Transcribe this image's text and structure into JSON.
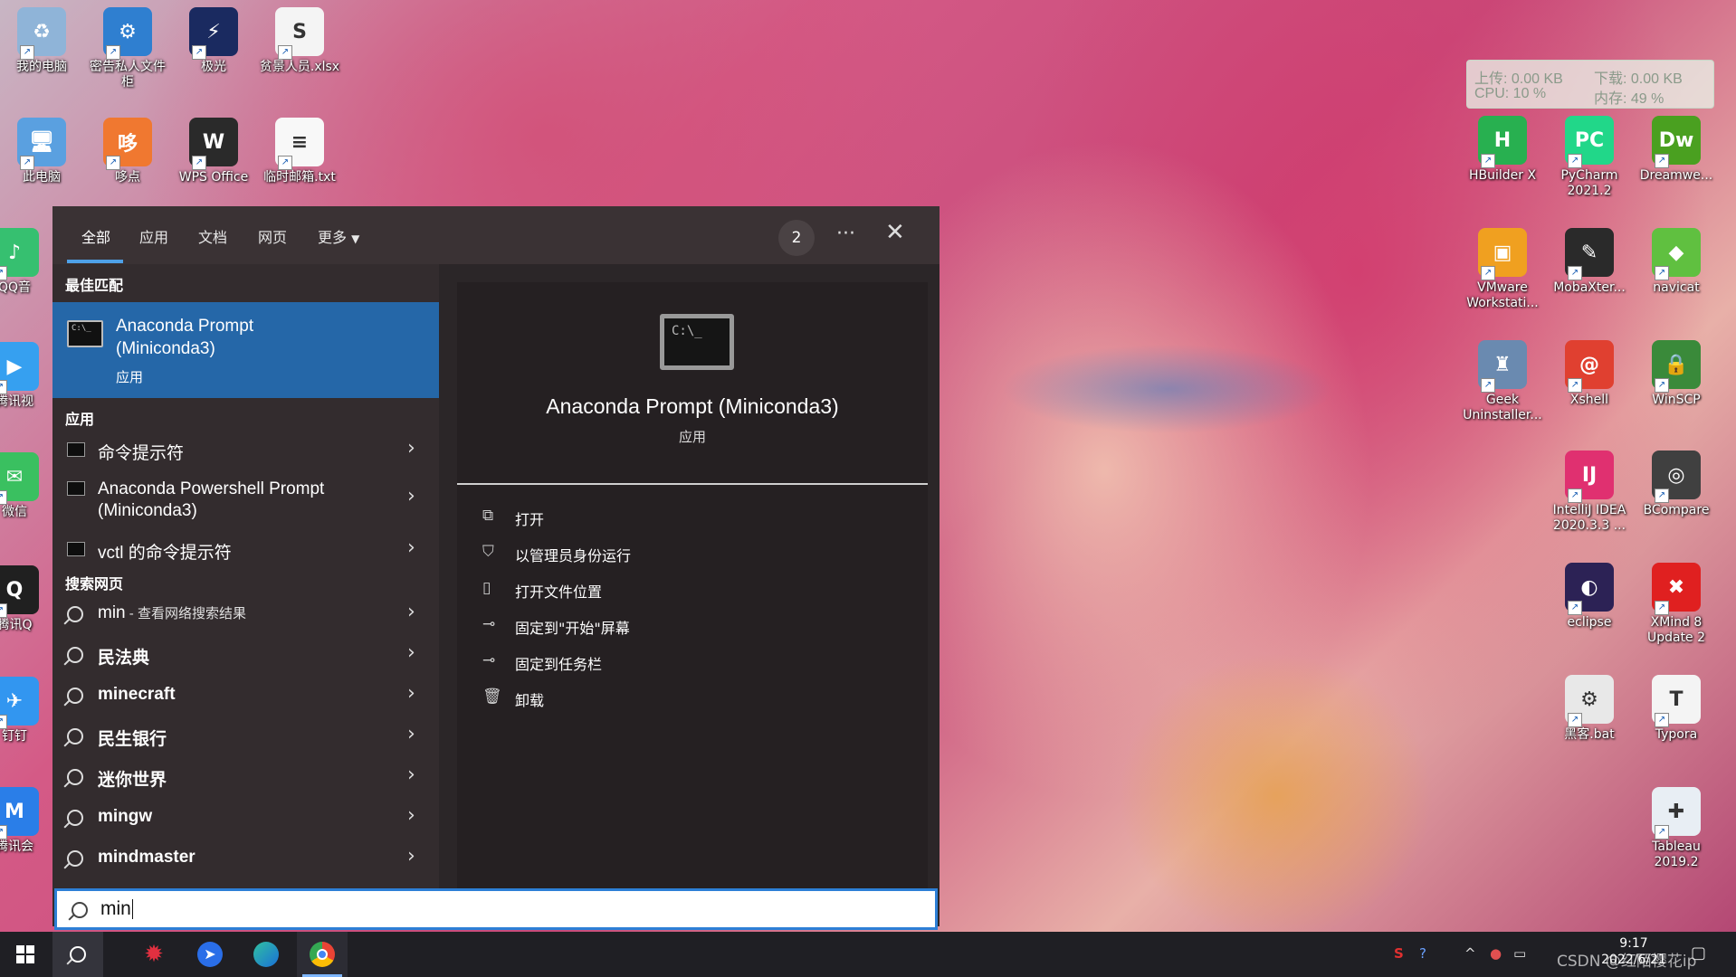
{
  "desktop": {
    "icons_left": [
      {
        "label": "我的电脑",
        "color": "#8fb4d8",
        "glyph": "♻"
      },
      {
        "label": "密告私人文件柜",
        "color": "#2f7fd0",
        "glyph": "⚙"
      },
      {
        "label": "极光",
        "color": "#1a2a60",
        "glyph": "⚡"
      },
      {
        "label": "贫景人员.xlsx",
        "color": "#f4f4f4",
        "glyph": "S"
      },
      {
        "label": "此电脑",
        "color": "#5aa0e0",
        "glyph": "🖥"
      },
      {
        "label": "哆点",
        "color": "#f07830",
        "glyph": "哆"
      },
      {
        "label": "WPS Office",
        "color": "#2a2a2a",
        "glyph": "W"
      },
      {
        "label": "临时邮箱.txt",
        "color": "#f8f8f8",
        "glyph": "≡"
      },
      {
        "label": "QQ音",
        "color": "#36c070",
        "glyph": "♪"
      },
      {
        "label": "腾讯视",
        "color": "#36a0f0",
        "glyph": "▶"
      },
      {
        "label": "微信",
        "color": "#3ac060",
        "glyph": "✉"
      },
      {
        "label": "腾讯Q",
        "color": "#202020",
        "glyph": "Q"
      },
      {
        "label": "钉钉",
        "color": "#3296f0",
        "glyph": "✈"
      },
      {
        "label": "腾讯会",
        "color": "#2a7ee8",
        "glyph": "M"
      }
    ],
    "icons_right": [
      {
        "label": "HBuilder X",
        "color": "#28b050",
        "glyph": "H"
      },
      {
        "label": "PyCharm 2021.2",
        "color": "#21d789",
        "glyph": "PC"
      },
      {
        "label": "Dreamwe...",
        "color": "#4aa020",
        "glyph": "Dw"
      },
      {
        "label": "VMware Workstati...",
        "color": "#f0a020",
        "glyph": "▣"
      },
      {
        "label": "MobaXter...",
        "color": "#2a2a2a",
        "glyph": "✎"
      },
      {
        "label": "navicat",
        "color": "#60c040",
        "glyph": "◆"
      },
      {
        "label": "Geek Uninstaller...",
        "color": "#6a8ab0",
        "glyph": "♜"
      },
      {
        "label": "Xshell",
        "color": "#e04030",
        "glyph": "@"
      },
      {
        "label": "WinSCP",
        "color": "#3a8a3a",
        "glyph": "🔒"
      },
      {
        "label": "IntelliJ IDEA 2020.3.3 ...",
        "color": "#e03070",
        "glyph": "IJ"
      },
      {
        "label": "BCompare",
        "color": "#404040",
        "glyph": "◎"
      },
      {
        "label": "eclipse",
        "color": "#2c2255",
        "glyph": "◐"
      },
      {
        "label": "XMind 8 Update 2",
        "color": "#e02020",
        "glyph": "✖"
      },
      {
        "label": "黑客.bat",
        "color": "#e8e8e8",
        "glyph": "⚙"
      },
      {
        "label": "Typora",
        "color": "#f4f4f4",
        "glyph": "T"
      },
      {
        "label": "Tableau 2019.2",
        "color": "#e8eef4",
        "glyph": "✚"
      }
    ]
  },
  "netmon": {
    "upload": "上传: 0.00 KB",
    "download": "下载: 0.00 KB",
    "cpu": "CPU: 10 %",
    "mem": "内存: 49 %"
  },
  "search_panel": {
    "tabs": [
      "全部",
      "应用",
      "文档",
      "网页",
      "更多"
    ],
    "badge": "2",
    "more_dots": "···",
    "close": "✕",
    "best_match_header": "最佳匹配",
    "best_match": {
      "title_line1": "Anaconda Prompt",
      "title_line2": "(Miniconda3)",
      "type": "应用"
    },
    "apps_header": "应用",
    "apps": [
      {
        "label": "命令提示符"
      },
      {
        "label": "Anaconda Powershell Prompt (Miniconda3)"
      },
      {
        "label": "vctl 的命令提示符"
      }
    ],
    "web_header": "搜索网页",
    "web_first": {
      "label": "min",
      "hint": " - 查看网络搜索结果"
    },
    "web_results": [
      "民法典",
      "minecraft",
      "民生银行",
      "迷你世界",
      "mingw",
      "mindmaster"
    ],
    "detail": {
      "icon_text": "C:\\_",
      "title": "Anaconda Prompt (Miniconda3)",
      "type": "应用",
      "actions": [
        {
          "label": "打开",
          "icon": "open-icon"
        },
        {
          "label": "以管理员身份运行",
          "icon": "shield-icon"
        },
        {
          "label": "打开文件位置",
          "icon": "folder-icon"
        },
        {
          "label": "固定到\"开始\"屏幕",
          "icon": "pin-icon"
        },
        {
          "label": "固定到任务栏",
          "icon": "pin-icon"
        },
        {
          "label": "卸载",
          "icon": "trash-icon"
        }
      ]
    }
  },
  "search_box": {
    "value": "min"
  },
  "taskbar": {
    "clock_time": "9:17",
    "clock_date": "2022/6/21",
    "watermark": "CSDN @红陌樱花ip"
  }
}
